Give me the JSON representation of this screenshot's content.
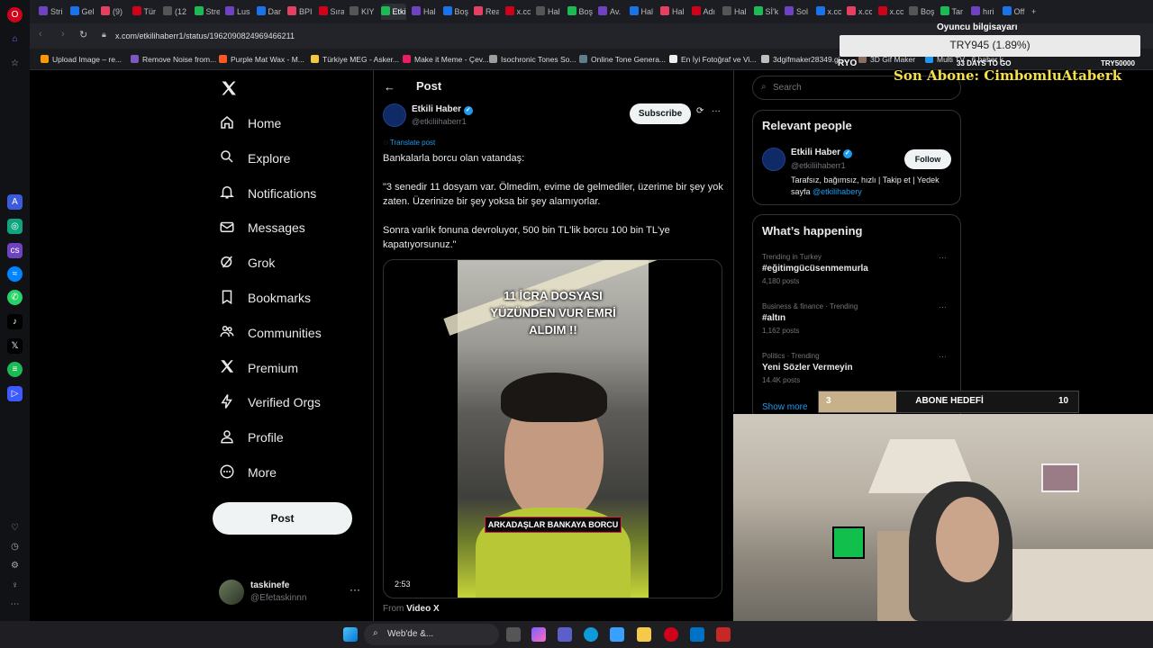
{
  "browser": {
    "tabs": [
      "Stri",
      "Gel",
      "(9)",
      "Tür",
      "(12",
      "Stre",
      "Lus",
      "Dar",
      "BPI",
      "Sıra",
      "KIY",
      "Etkili H",
      "Hal",
      "Boş",
      "Rea",
      "x.cc",
      "Hal",
      "Boş",
      "Av.",
      "Hal",
      "Hal",
      "Adı",
      "Hal",
      "Sİ'k",
      "Sol",
      "x.cc",
      "x.cc",
      "x.cc",
      "Boş",
      "Tar",
      "hıri",
      "Off"
    ],
    "url": "x.com/etkilihaberr1/status/1962090824969466211",
    "bookmarks": [
      "Upload Image – re...",
      "Remove Noise from...",
      "Purple Mat Wax - M...",
      "Türkiye MEG - Asker...",
      "Make it Meme - Çev...",
      "Isochronic Tones So...",
      "Online Tone Genera...",
      "En İyi Fotoğraf ve Vi...",
      "3dgifmaker28349.gi...",
      "3D Gif Maker",
      "Multi TV - 6 haber k..."
    ]
  },
  "nav": {
    "items": [
      {
        "label": "Home",
        "icon": "home-icon"
      },
      {
        "label": "Explore",
        "icon": "search-icon"
      },
      {
        "label": "Notifications",
        "icon": "bell-icon"
      },
      {
        "label": "Messages",
        "icon": "envelope-icon"
      },
      {
        "label": "Grok",
        "icon": "grok-icon"
      },
      {
        "label": "Bookmarks",
        "icon": "bookmark-icon"
      },
      {
        "label": "Communities",
        "icon": "people-icon"
      },
      {
        "label": "Premium",
        "icon": "x-logo-icon"
      },
      {
        "label": "Verified Orgs",
        "icon": "lightning-icon"
      },
      {
        "label": "Profile",
        "icon": "person-icon"
      },
      {
        "label": "More",
        "icon": "more-circle-icon"
      }
    ],
    "post_button": "Post",
    "account": {
      "name": "taskinefe",
      "handle": "@Efetaskinnn"
    }
  },
  "post": {
    "header": "Post",
    "author_name": "Etkili Haber",
    "author_handle": "@etkiIiihaberr1",
    "subscribe": "Subscribe",
    "translate": "Translate post",
    "text1": "Bankalarla borcu olan vatandaş:",
    "text2": "\"3 senedir 11 dosyam var. Ölmedim, evime de gelmediler, üzerime bir şey yok zaten. Üzerinize bir şey yoksa bir şey alamıyorlar.",
    "text3": "Sonra varlık fonuna devroluyor, 500 bin TL'lik borcu 100 bin TL'ye kapatıyorsunuz.\"",
    "video_caption_top": "11 İCRA DOSYASI YÜZÜNDEN VUR EMRİ ALDIM !!",
    "video_caption_bottom": "ARKADAŞLAR BANKAYA BORCU",
    "video_duration": "2:53",
    "from_label": "From",
    "from_source": "Video X"
  },
  "sidebar": {
    "search_placeholder": "Search",
    "relevant_title": "Relevant people",
    "person_name": "Etkili Haber",
    "person_handle": "@etkiIiihaberr1",
    "follow": "Follow",
    "bio": "Tarafsız, bağımsız, hızlı | Takip et | Yedek sayfa",
    "bio_link": "@etkilihabery",
    "happening_title": "What’s happening",
    "trends": [
      {
        "meta": "Trending in Turkey",
        "name": "#eğitimgücüsenmemurla",
        "count": "4,180 posts"
      },
      {
        "meta": "Business & finance · Trending",
        "name": "#altın",
        "count": "1,162 posts"
      },
      {
        "meta": "Politics · Trending",
        "name": "Yeni Sözler Vermeyin",
        "count": "14.4K posts"
      }
    ],
    "show_more": "Show more"
  },
  "overlay": {
    "player_computer": "Oyuncu bilgisayarı",
    "price": "TRY945 (1.89%)",
    "days_to_go": "33 DAYS TO GO",
    "left_code": "RYO",
    "right_code": "TRY50000",
    "last_sub": "Son Abone: CimbomluAtaberk",
    "goal_current": "3",
    "goal_label": "ABONE HEDEFİ",
    "goal_target": "10",
    "goal_fraction": 0.3
  },
  "taskbar": {
    "search_text": "Web'de &..."
  },
  "colors": {
    "accent": "#1d9bf0",
    "goal_bar": "#c8b08a",
    "streak_text": "#f5e04a"
  }
}
